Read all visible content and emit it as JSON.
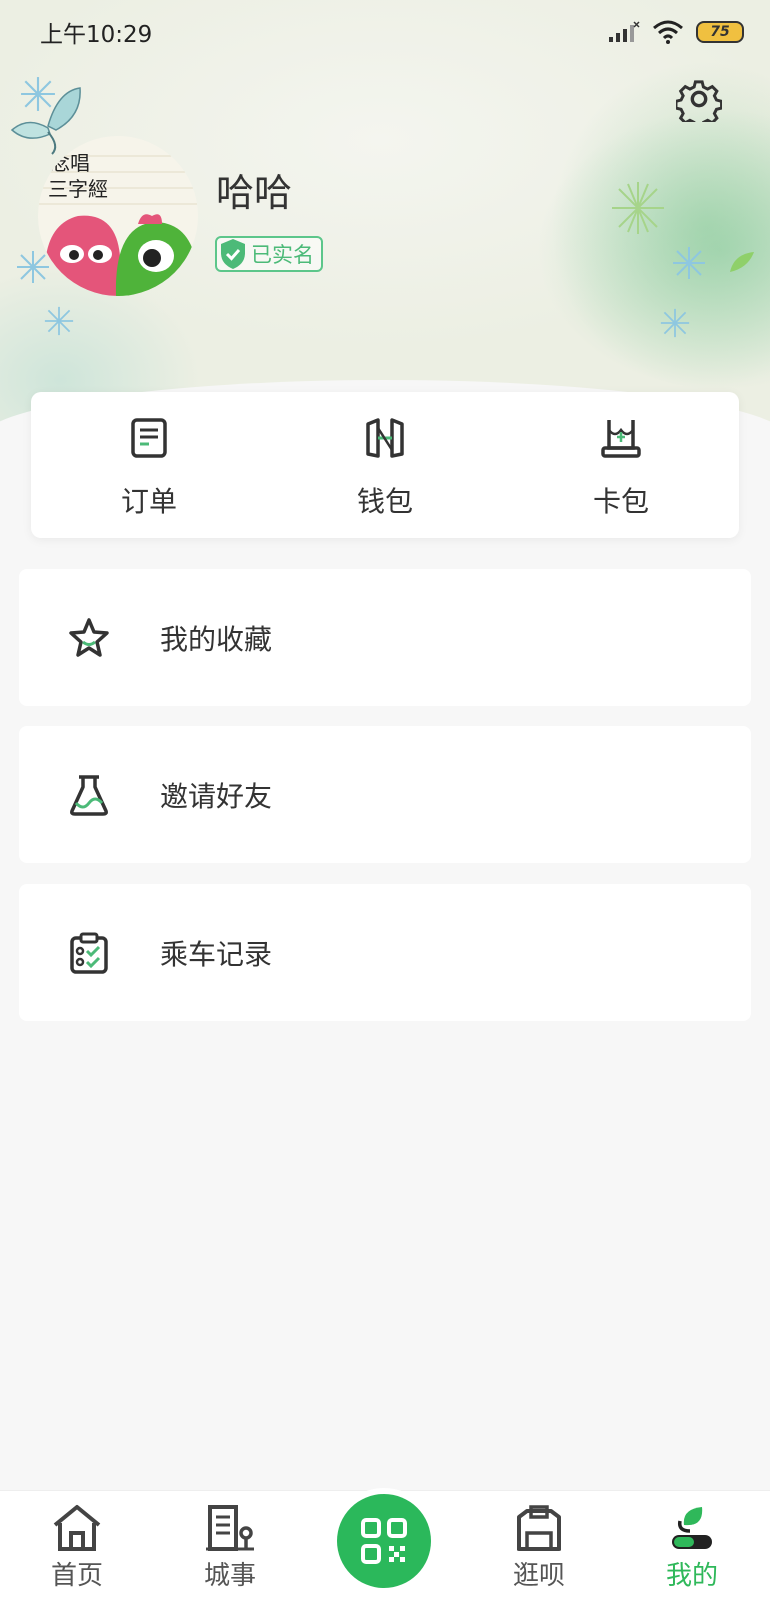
{
  "status_bar": {
    "time": "上午10:29",
    "battery": "75"
  },
  "profile": {
    "username": "哈哈",
    "verified_label": "已实名",
    "avatar_text_line1": "念唱",
    "avatar_text_line2": "三字經"
  },
  "quick_actions": [
    {
      "label": "订单",
      "icon": "order-icon"
    },
    {
      "label": "钱包",
      "icon": "wallet-icon"
    },
    {
      "label": "卡包",
      "icon": "card-package-icon"
    }
  ],
  "menu": [
    {
      "label": "我的收藏",
      "icon": "star-icon"
    },
    {
      "label": "邀请好友",
      "icon": "invite-icon"
    },
    {
      "label": "乘车记录",
      "icon": "clipboard-check-icon"
    }
  ],
  "bottom_nav": {
    "items": [
      {
        "label": "首页",
        "icon": "home-icon"
      },
      {
        "label": "城事",
        "icon": "city-icon"
      },
      {
        "label": "逛呗",
        "icon": "shop-icon"
      },
      {
        "label": "我的",
        "icon": "user-icon",
        "active": true
      }
    ],
    "center_icon": "qr-scan-icon"
  },
  "colors": {
    "accent": "#2bb85b",
    "verified": "#4cba78",
    "background": "#f7f7f7"
  }
}
